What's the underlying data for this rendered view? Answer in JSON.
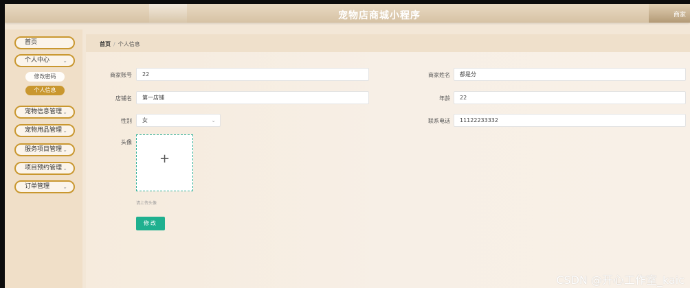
{
  "header": {
    "title": "宠物店商城小程序",
    "user_label": "商家"
  },
  "sidebar": {
    "items": [
      {
        "label": "首页",
        "chev": ""
      },
      {
        "label": "个人中心",
        "chev": "⌄"
      },
      {
        "label": "宠物信息管理",
        "chev": "⌄"
      },
      {
        "label": "宠物用品管理",
        "chev": "⌄"
      },
      {
        "label": "服务项目管理",
        "chev": "⌄"
      },
      {
        "label": "项目预约管理",
        "chev": "⌄"
      },
      {
        "label": "订单管理",
        "chev": "⌄"
      }
    ],
    "sub_items": [
      {
        "label": "修改密码"
      },
      {
        "label": "个人信息"
      }
    ]
  },
  "breadcrumb": {
    "home": "首页",
    "separator": "/",
    "current": "个人信息"
  },
  "form": {
    "merchant_account": {
      "label": "商家账号",
      "value": "22"
    },
    "merchant_name": {
      "label": "商家姓名",
      "value": "都是分"
    },
    "shop_name": {
      "label": "店铺名",
      "value": "第一店铺"
    },
    "age": {
      "label": "年龄",
      "value": "22"
    },
    "gender": {
      "label": "性别",
      "value": "女",
      "chev": "⌄"
    },
    "phone": {
      "label": "联系电话",
      "value": "11122233332"
    },
    "avatar": {
      "label": "头像",
      "tip": "请上传头像",
      "plus": "+"
    },
    "submit_label": "修改"
  },
  "watermark": "CSDN @开心工作室_kaic",
  "colors": {
    "accent": "#c9972f",
    "primary_button": "#1fb08f",
    "upload_border": "#34b29a"
  }
}
